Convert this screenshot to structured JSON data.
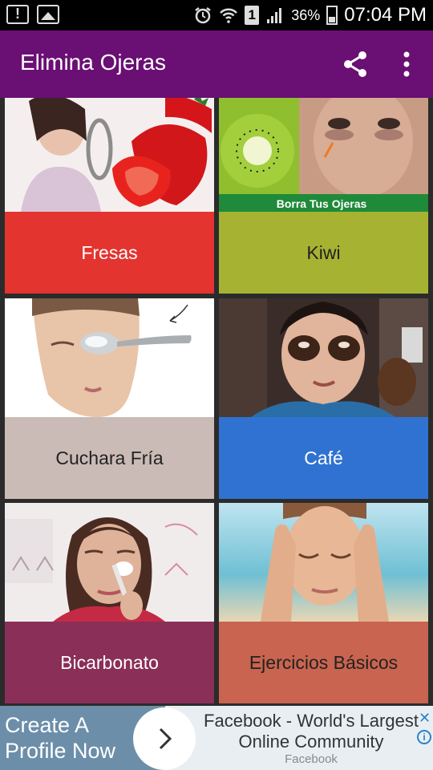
{
  "status_bar": {
    "battery": "36%",
    "time": "07:04 PM",
    "sim_slot": "1",
    "icons": [
      "notice-icon",
      "image-icon",
      "alarm-icon",
      "wifi-icon",
      "signal-icon",
      "battery-icon"
    ]
  },
  "app_bar": {
    "title": "Elimina Ojeras",
    "actions": [
      "share-icon",
      "more-options-icon"
    ],
    "color": "#6a0f74"
  },
  "cards": [
    {
      "label": "Fresas",
      "color": "#e3342f",
      "text_color": "#ffffff",
      "image": "strawberries-photo"
    },
    {
      "label": "Kiwi",
      "color": "#a6b332",
      "text_color": "#222222",
      "image": "kiwi-photo",
      "image_caption": "Borra Tus Ojeras"
    },
    {
      "label": "Cuchara Fría",
      "color": "#cbbbb6",
      "text_color": "#222222",
      "image": "cold-spoon-photo"
    },
    {
      "label": "Café",
      "color": "#2f72d1",
      "text_color": "#ffffff",
      "image": "coffee-mask-photo"
    },
    {
      "label": "Bicarbonato",
      "color": "#8a2f57",
      "text_color": "#ffffff",
      "image": "baking-soda-photo"
    },
    {
      "label": "Ejercicios Básicos",
      "color": "#c8644f",
      "text_color": "#222222",
      "image": "eye-exercise-photo"
    }
  ],
  "ad": {
    "headline": "Create A Profile Now",
    "text": "Facebook - World's Largest Online Community",
    "source": "Facebook",
    "close": "✕",
    "info": "i"
  }
}
